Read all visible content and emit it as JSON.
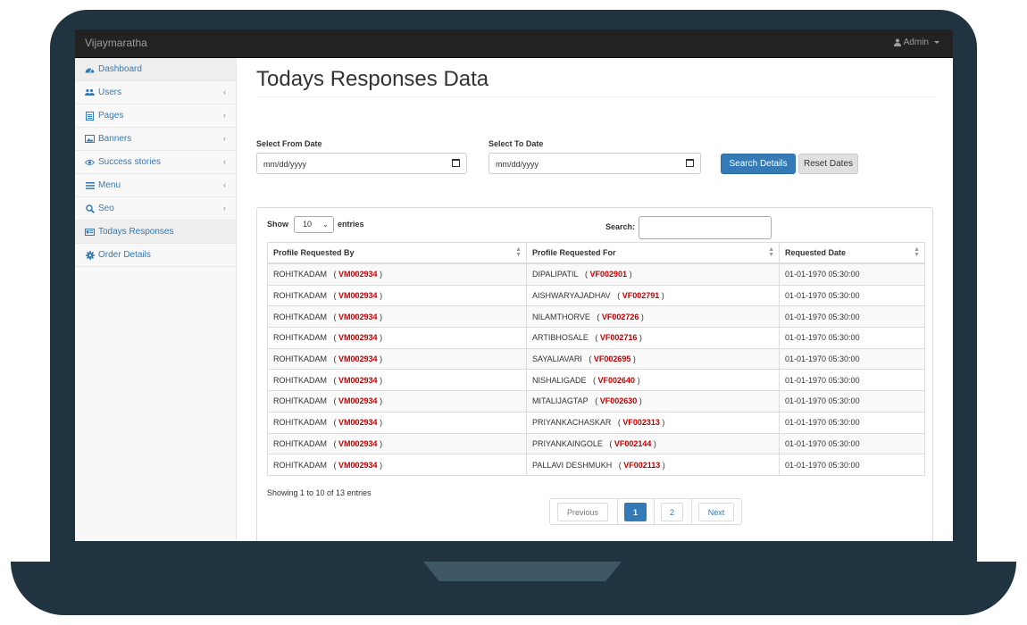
{
  "app": {
    "brand": "Vijaymaratha",
    "user_label": "Admin"
  },
  "sidebar": {
    "items": [
      {
        "label": "Dashboard",
        "icon": "dashboard-icon",
        "has_submenu": false
      },
      {
        "label": "Users",
        "icon": "users-icon",
        "has_submenu": true
      },
      {
        "label": "Pages",
        "icon": "page-icon",
        "has_submenu": true
      },
      {
        "label": "Banners",
        "icon": "image-icon",
        "has_submenu": true
      },
      {
        "label": "Success stories",
        "icon": "eye-icon",
        "has_submenu": true
      },
      {
        "label": "Menu",
        "icon": "bars-icon",
        "has_submenu": true
      },
      {
        "label": "Seo",
        "icon": "search-icon",
        "has_submenu": true
      },
      {
        "label": "Todays Responses",
        "icon": "id-card-icon",
        "has_submenu": false
      },
      {
        "label": "Order Details",
        "icon": "gear-icon",
        "has_submenu": false
      }
    ]
  },
  "main": {
    "title": "Todays Responses Data",
    "from_label": "Select From Date",
    "to_label": "Select To Date",
    "from_value": "mm/dd/yyyy",
    "to_value": "mm/dd/yyyy",
    "search_btn": "Search Details",
    "reset_btn": "Reset Dates"
  },
  "table": {
    "show_label": "Show",
    "page_size": "10",
    "entries_label": "entries",
    "search_label": "Search:",
    "columns": [
      "Profile Requested By",
      "Profile Requested For",
      "Requested Date"
    ],
    "rows": [
      {
        "by_name": "ROHITKADAM",
        "by_code": "VM002934",
        "for_name": "DIPALIPATIL",
        "for_code": "VF002901",
        "date": "01-01-1970 05:30:00"
      },
      {
        "by_name": "ROHITKADAM",
        "by_code": "VM002934",
        "for_name": "AISHWARYAJADHAV",
        "for_code": "VF002791",
        "date": "01-01-1970 05:30:00"
      },
      {
        "by_name": "ROHITKADAM",
        "by_code": "VM002934",
        "for_name": "NILAMTHORVE",
        "for_code": "VF002726",
        "date": "01-01-1970 05:30:00"
      },
      {
        "by_name": "ROHITKADAM",
        "by_code": "VM002934",
        "for_name": "ARTIBHOSALE",
        "for_code": "VF002716",
        "date": "01-01-1970 05:30:00"
      },
      {
        "by_name": "ROHITKADAM",
        "by_code": "VM002934",
        "for_name": "SAYALIAVARI",
        "for_code": "VF002695",
        "date": "01-01-1970 05:30:00"
      },
      {
        "by_name": "ROHITKADAM",
        "by_code": "VM002934",
        "for_name": "NISHALIGADE",
        "for_code": "VF002640",
        "date": "01-01-1970 05:30:00"
      },
      {
        "by_name": "ROHITKADAM",
        "by_code": "VM002934",
        "for_name": "MITALIJAGTAP",
        "for_code": "VF002630",
        "date": "01-01-1970 05:30:00"
      },
      {
        "by_name": "ROHITKADAM",
        "by_code": "VM002934",
        "for_name": "PRIYANKACHASKAR",
        "for_code": "VF002313",
        "date": "01-01-1970 05:30:00"
      },
      {
        "by_name": "ROHITKADAM",
        "by_code": "VM002934",
        "for_name": "PRIYANKAINGOLE",
        "for_code": "VF002144",
        "date": "01-01-1970 05:30:00"
      },
      {
        "by_name": "ROHITKADAM",
        "by_code": "VM002934",
        "for_name": "PALLAVI DESHMUKH",
        "for_code": "VF002113",
        "date": "01-01-1970 05:30:00"
      }
    ],
    "info": "Showing 1 to 10 of 13 entries",
    "pagination": {
      "previous": "Previous",
      "pages": [
        "1",
        "2"
      ],
      "current": "1",
      "next": "Next"
    }
  },
  "colors": {
    "primary": "#337ab7",
    "code_red": "#c00000",
    "navbar": "#222222",
    "frame": "#1f3440"
  }
}
